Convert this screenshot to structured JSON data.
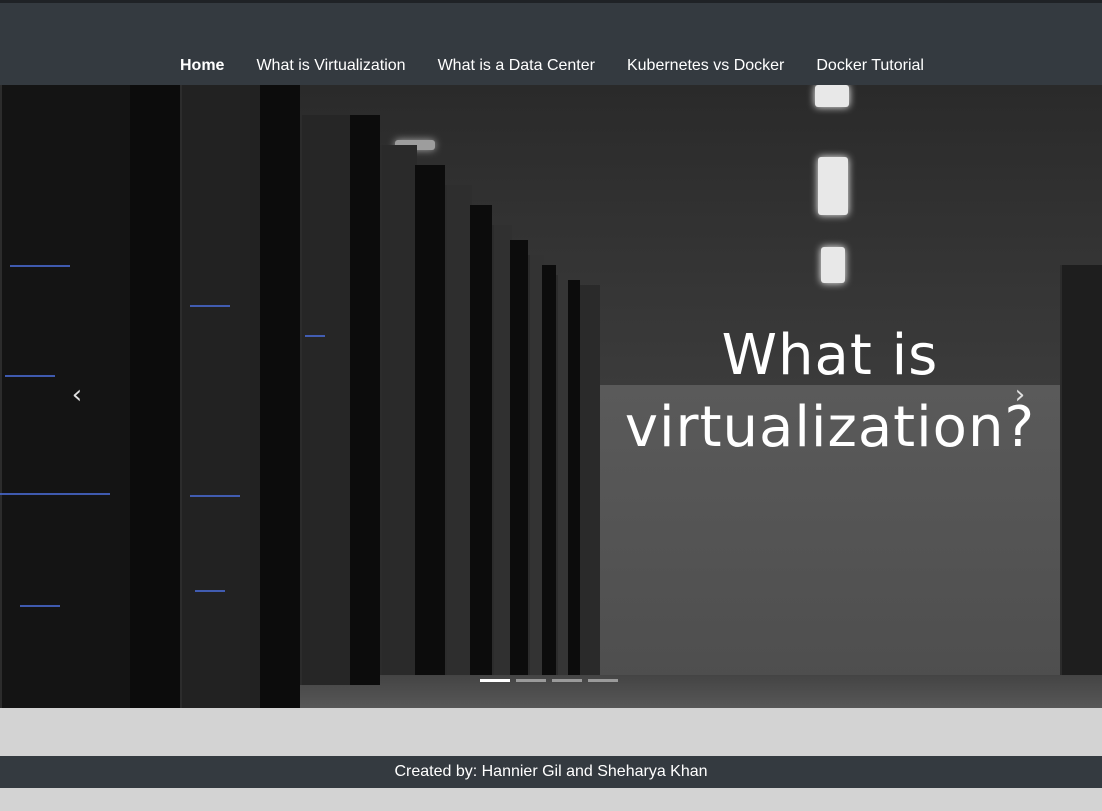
{
  "nav": {
    "items": [
      {
        "label": "Home",
        "active": true
      },
      {
        "label": "What is Virtualization"
      },
      {
        "label": "What is a Data Center"
      },
      {
        "label": "Kubernetes vs Docker"
      },
      {
        "label": "Docker Tutorial"
      }
    ]
  },
  "carousel": {
    "headline_line1": "What is",
    "headline_line2": "virtualization?",
    "prev_icon": "‹",
    "next_icon": "›",
    "indicator_count": 4,
    "active_indicator": 1
  },
  "footer": {
    "text": "Created by: Hannier Gil and Sheharya Khan"
  },
  "colors": {
    "navbar": "#343a40",
    "page_background": "#d3d3d3",
    "text": "#ffffff"
  }
}
